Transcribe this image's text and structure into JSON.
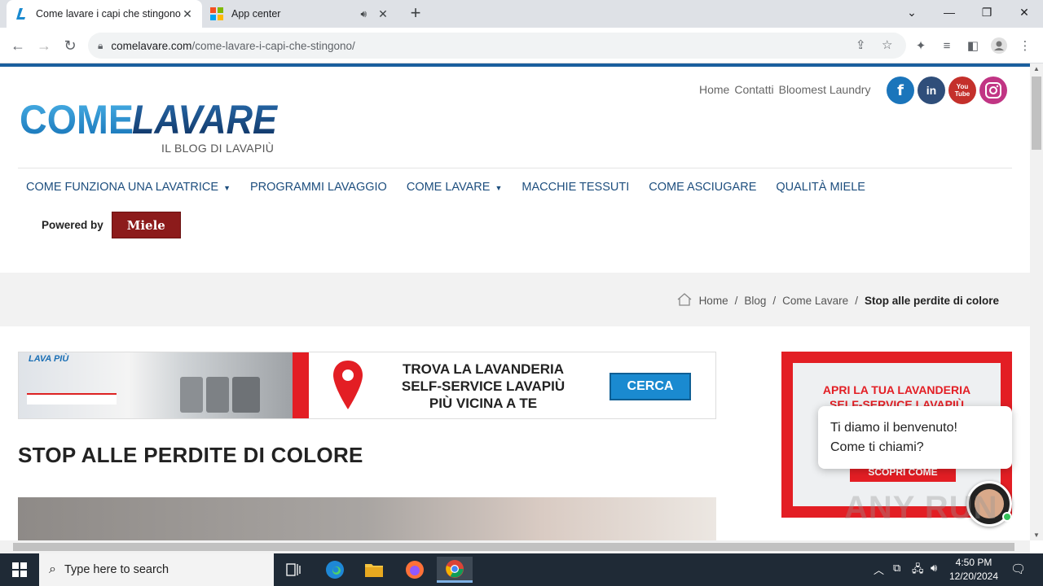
{
  "browser": {
    "tabs": [
      {
        "title": "Come lavare i capi che stingono",
        "active": true,
        "icon": "lavapiu-favicon"
      },
      {
        "title": "App center",
        "active": false,
        "icon": "microsoft-favicon"
      }
    ],
    "address": {
      "domain": "comelavare.com",
      "path": "/come-lavare-i-capi-che-stingono/"
    }
  },
  "site": {
    "logo_text_a": "COME",
    "logo_text_b": "LAVARE",
    "tagline": "IL BLOG DI LAVAPIÙ",
    "toplinks": [
      "Home",
      "Contatti",
      "Bloomest Laundry"
    ],
    "social": [
      "facebook-icon",
      "linkedin-icon",
      "youtube-icon",
      "instagram-icon"
    ],
    "social_text": {
      "facebook": "f",
      "linkedin": "in",
      "youtube": "You Tube"
    },
    "menu": [
      {
        "label": "COME FUNZIONA UNA LAVATRICE",
        "dropdown": true
      },
      {
        "label": "PROGRAMMI LAVAGGIO",
        "dropdown": false
      },
      {
        "label": "COME LAVARE",
        "dropdown": true
      },
      {
        "label": "MACCHIE TESSUTI",
        "dropdown": false
      },
      {
        "label": "COME ASCIUGARE",
        "dropdown": false
      },
      {
        "label": "QUALITÀ MIELE",
        "dropdown": false
      }
    ],
    "powered_by": "Powered by",
    "powered_brand": "Miele",
    "breadcrumbs": [
      "Home",
      "Blog",
      "Come Lavare",
      "Stop alle perdite di colore"
    ],
    "banner": {
      "line1": "TROVA LA LAVANDERIA",
      "line2": "SELF-SERVICE LAVAPIÙ",
      "line3": "PIÙ VICINA A TE",
      "button": "CERCA",
      "photo_brand": "LAVA PIÙ"
    },
    "article_title": "STOP ALLE PERDITE DI COLORE",
    "side_banner": {
      "line1": "APRI LA TUA LAVANDERIA",
      "line2": "SELF-SERVICE LAVAPIÙ",
      "button": "SCOPRI COME"
    },
    "chat": {
      "line1": "Ti diamo il benvenuto!",
      "line2": "Come ti chiami?"
    }
  },
  "taskbar": {
    "search_placeholder": "Type here to search",
    "time": "4:50 PM",
    "date": "12/20/2024"
  },
  "watermark": "ANY RUN",
  "colors": {
    "brand_blue": "#1b5f9e",
    "menu_blue": "#1d4e7e",
    "lavapiu_red": "#e31e24",
    "miele_red": "#8c1b1b"
  }
}
